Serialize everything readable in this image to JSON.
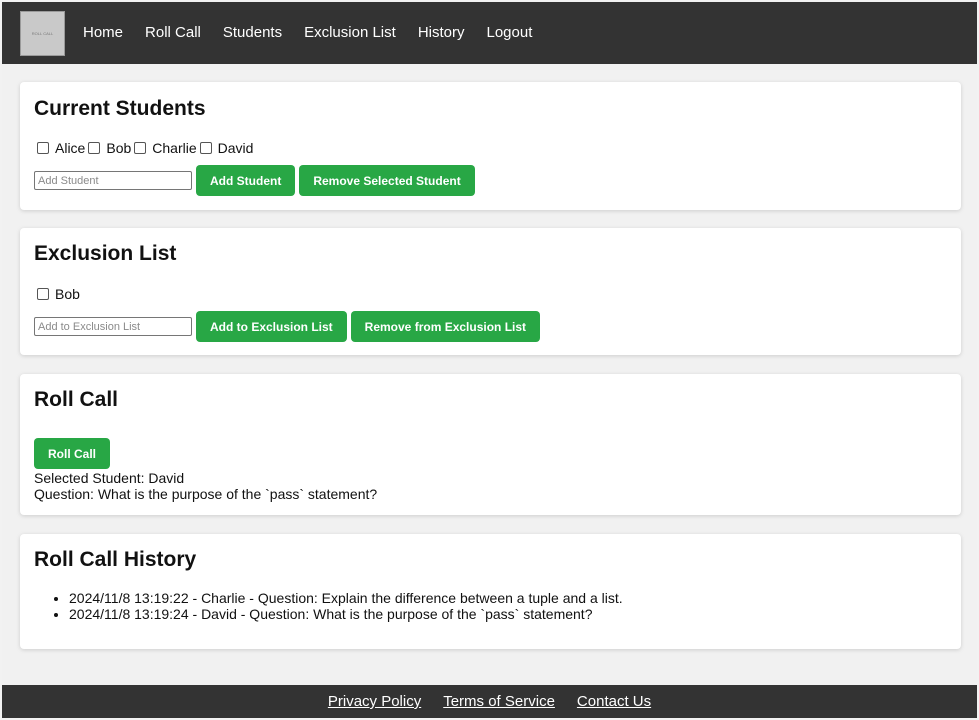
{
  "nav": {
    "logo_text": "ROLL CALL",
    "links": [
      "Home",
      "Roll Call",
      "Students",
      "Exclusion List",
      "History",
      "Logout"
    ]
  },
  "current_students": {
    "title": "Current Students",
    "students": [
      "Alice",
      "Bob",
      "Charlie",
      "David"
    ],
    "input_placeholder": "Add Student",
    "add_button": "Add Student",
    "remove_button": "Remove Selected Student"
  },
  "exclusion_list": {
    "title": "Exclusion List",
    "students": [
      "Bob"
    ],
    "input_placeholder": "Add to Exclusion List",
    "add_button": "Add to Exclusion List",
    "remove_button": "Remove from Exclusion List"
  },
  "roll_call": {
    "title": "Roll Call",
    "button": "Roll Call",
    "selected_student": "Selected Student: David",
    "question": "Question: What is the purpose of the `pass` statement?"
  },
  "history": {
    "title": "Roll Call History",
    "entries": [
      "2024/11/8 13:19:22 - Charlie - Question: Explain the difference between a tuple and a list.",
      "2024/11/8 13:19:24 - David - Question: What is the purpose of the `pass` statement?"
    ]
  },
  "footer": {
    "links": [
      "Privacy Policy",
      "Terms of Service",
      "Contact Us"
    ]
  },
  "colors": {
    "accent": "#28a745",
    "nav_bg": "#333333"
  }
}
